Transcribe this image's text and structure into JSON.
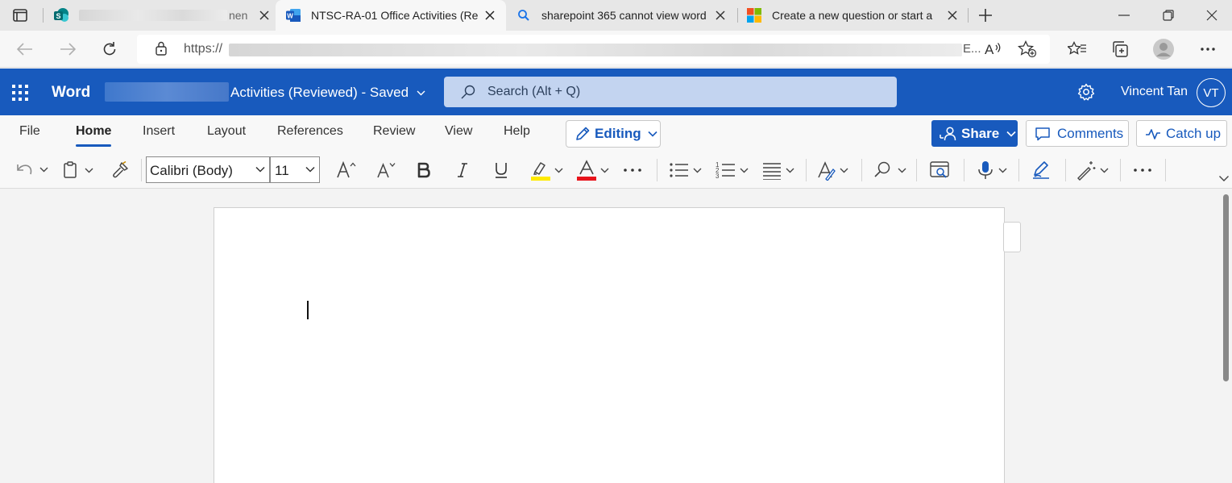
{
  "browser": {
    "tabs": [
      {
        "title": "nen",
        "active": false
      },
      {
        "title": "NTSC-RA-01 Office Activities (Re",
        "active": true
      },
      {
        "title": "sharepoint 365 cannot view word",
        "active": false
      },
      {
        "title": "Create a new question or start a",
        "active": false
      }
    ],
    "address": {
      "prefix": "https://",
      "suffix": "E..."
    }
  },
  "word": {
    "app_name": "Word",
    "doc_title": "Activities (Reviewed)  -  Saved",
    "search_placeholder": "Search (Alt + Q)",
    "user_name": "Vincent Tan",
    "user_initials": "VT"
  },
  "ribbon": {
    "tabs": [
      "File",
      "Home",
      "Insert",
      "Layout",
      "References",
      "Review",
      "View",
      "Help"
    ],
    "active_tab": "Home",
    "mode_label": "Editing",
    "share_label": "Share",
    "comments_label": "Comments",
    "catchup_label": "Catch up"
  },
  "toolbar": {
    "font_name": "Calibri (Body)",
    "font_size": "11",
    "highlight_color": "#ffea00",
    "font_color": "#e8141c"
  },
  "colors": {
    "brand": "#185abd",
    "search_bg": "#c3d4f0"
  }
}
